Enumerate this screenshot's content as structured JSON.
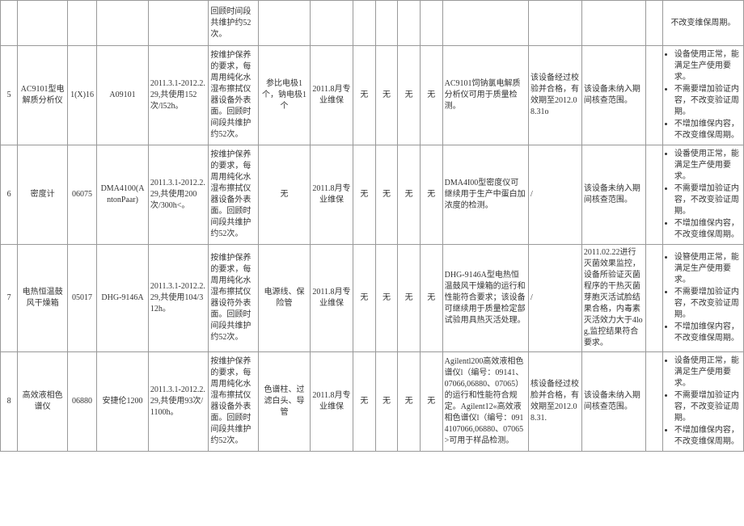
{
  "topPartialRow": {
    "c6": "回顾时间段共维护约52次。",
    "c17": "不改变维保周期。"
  },
  "rows": [
    {
      "no": "5",
      "device": "AC9101型电解质分析仪",
      "serial": "1(X)16",
      "model": "A09101",
      "period": "2011.3.1-2012.2.29,共使用152次/l52h。",
      "maint": "按维护保养的要求，每周用纯化水湿布擦拭仪器设备外表面。回顾时间段共维护约52次。",
      "parts": "参比电极1个，钠电极1个",
      "service": "2011.8月专业维保",
      "c9": "无",
      "c10": "无",
      "c11": "无",
      "c12": "无",
      "c13": "AC9101饲钠氯电解质分析仪可用于质量检测。",
      "c14": "该设备经过校验并合格，有效期至2012.08.31o",
      "c15": "该设备未纳入期间核查范围。",
      "c16": "",
      "c17": [
        "设备使用正常，能满足生产使用要求。",
        "不需要增加验证内容，不改变验证周期。",
        "不增加维保内容，不改变维保周期。"
      ]
    },
    {
      "no": "6",
      "device": "密度计",
      "serial": "06075",
      "model": "DMA4100(AntonPaar)",
      "period": "2011.3.1-2012.2.29,共使用200次/300h<。",
      "maint": "按维护保养的要求，每周用纯化水湿布擦拭仪器设备外表面。回顾时间段共维护约52次。",
      "parts": "无",
      "service": "2011.8月专业维保",
      "c9": "无",
      "c10": "无",
      "c11": "无",
      "c12": "无",
      "c13": "DMA4I00型密度仪可继续用于生产中蛋白加浓度的检测。",
      "c14": "/",
      "c15": "该设备未纳入期间核查范围。",
      "c16": "",
      "c17": [
        "设番使用正常，能满足生产使用要求。",
        "不需要增加验证内容，不改变验证周期。",
        "不增加维保内容，不改变维保周期。"
      ]
    },
    {
      "no": "7",
      "device": "电热恒温鼓风干燥箱",
      "serial": "05017",
      "model": "DHG-9146A",
      "period": "2011.3.1-2012.2.29,共使用104/312h。",
      "maint": "按维护保养的要求，每周用纯化水湿布擦拭仪器设符外表面。回顾时间段共维护约52次。",
      "parts": "电源线、保险管",
      "service": "2011.8月专业维保",
      "c9": "无",
      "c10": "无",
      "c11": "无",
      "c12": "无",
      "c13": "DHG-9146A型电热恒温鼓风干燥箱的运行和性能符合要求；该设备可继续用于质量检定部试验用具热灭活处理。",
      "c14": "/",
      "c15": "2011.02.22进行灭菌效果监控，设备所验证灭菌程序的干热灭菌芽胞灭活试脸结果合格，内毒素灭活效力大于4log,监控结果符合要求。",
      "c16": "",
      "c17": [
        "设簪使用正常，能满足生产使用要求。",
        "不需要增加验证内容，不改变验证周期。",
        "不增加维保内容，不改变维保周期。"
      ]
    },
    {
      "no": "8",
      "device": "高效液相色谱仪",
      "serial": "06880",
      "model": "安捷伦1200",
      "period": "2011.3.1-2012.2.29,共使用93次/1100h。",
      "maint": "按维护保养的要求，每周用纯化水湿布擦拭仪器设备外表面。回顾时间段共维护约52次。",
      "parts": "色谱柱、过滤白头、导管",
      "service": "2011.8月专业维保",
      "c9": "无",
      "c10": "无",
      "c11": "无",
      "c12": "无",
      "c13": "Agilentl200高效液相色谱仪l（编号：09141、07066,06880、07065）的运行和性能符合规定。Agilent12«高效液相色谱仪l（编号：0914107066,06880、07065>可用于样品检测。",
      "c14": "核设备经过校脸并合格，有效期至2012.08.31.",
      "c15": "该设备未纳入期间核查范围。",
      "c16": "",
      "c17": [
        "设备使用正常，能满足生产使用要求。",
        "不需要增加验证内容，不改变验证周期。",
        "不增加维保内容，不改变维保周期。"
      ]
    }
  ]
}
